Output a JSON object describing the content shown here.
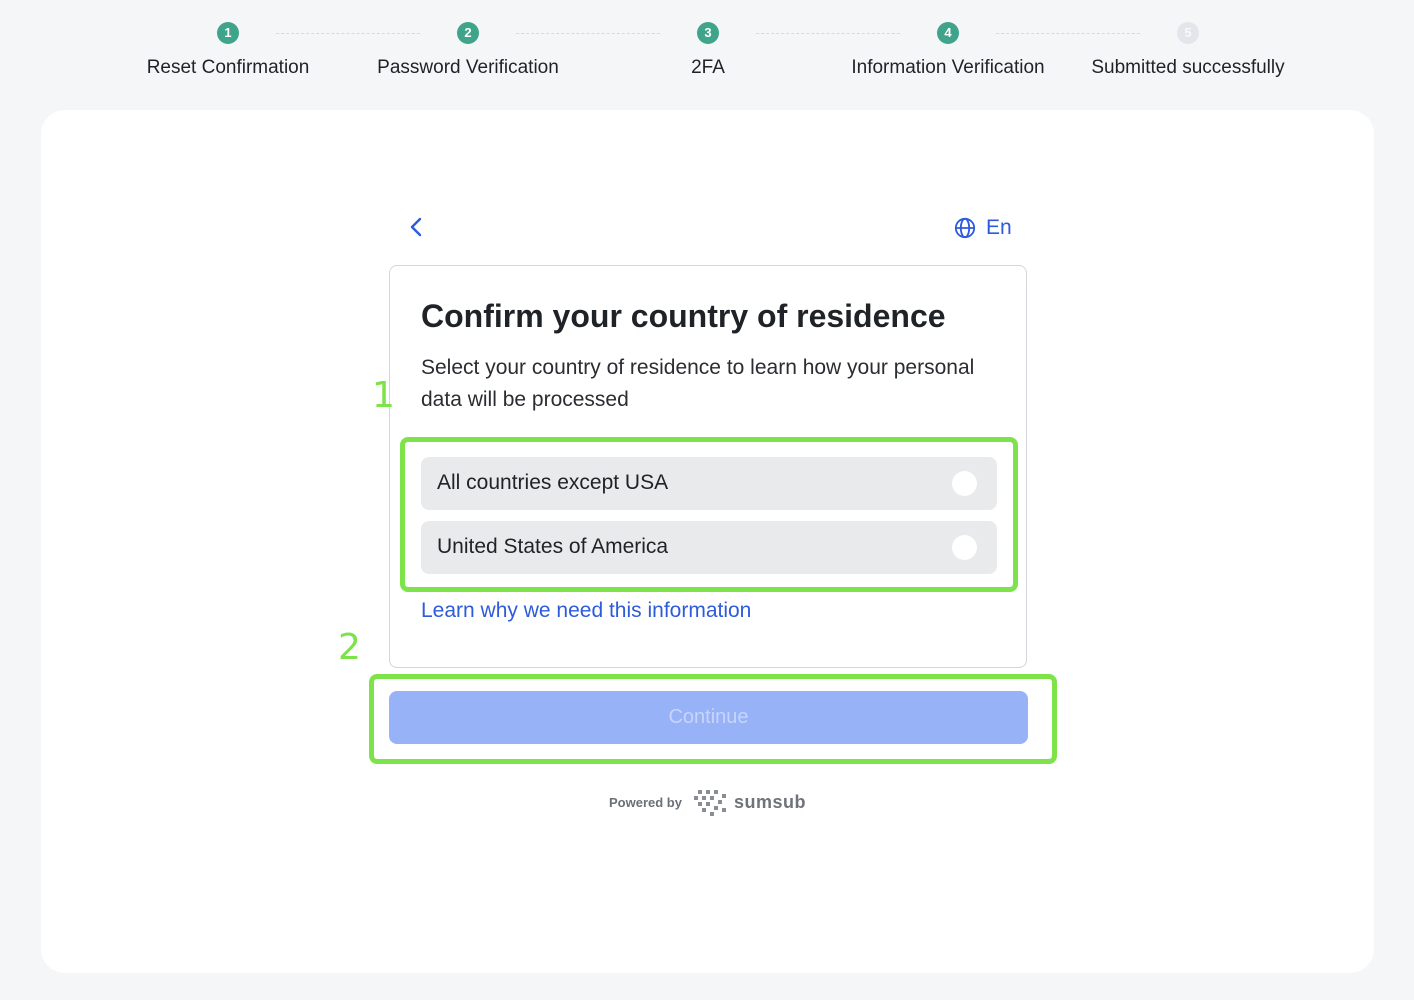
{
  "stepper": {
    "steps": [
      {
        "number": "1",
        "label": "Reset Confirmation",
        "status": "done"
      },
      {
        "number": "2",
        "label": "Password Verification",
        "status": "done"
      },
      {
        "number": "3",
        "label": "2FA",
        "status": "done"
      },
      {
        "number": "4",
        "label": "Information Verification",
        "status": "done"
      },
      {
        "number": "5",
        "label": "Submitted successfully",
        "status": "pending"
      }
    ]
  },
  "header": {
    "back_icon": "chevron-left-icon",
    "language_icon": "globe-icon",
    "language_label": "En"
  },
  "panel": {
    "title": "Confirm your country of residence",
    "subtitle": "Select your country of residence to learn how your personal data will be processed",
    "options": [
      {
        "label": "All countries except USA",
        "selected": false
      },
      {
        "label": "United States of America",
        "selected": false
      }
    ],
    "learn_link": "Learn why we need this information"
  },
  "continue_button": {
    "label": "Continue",
    "enabled": false
  },
  "footer": {
    "powered_by": "Powered by",
    "brand": "sumsub"
  },
  "annotations": {
    "first": "1",
    "second": "2"
  },
  "colors": {
    "accent_blue": "#2d5bdb",
    "step_done": "#3fa48b",
    "step_pending": "#e2e5e9",
    "highlight": "#7ee34b",
    "continue_disabled": "#98b2f7"
  }
}
